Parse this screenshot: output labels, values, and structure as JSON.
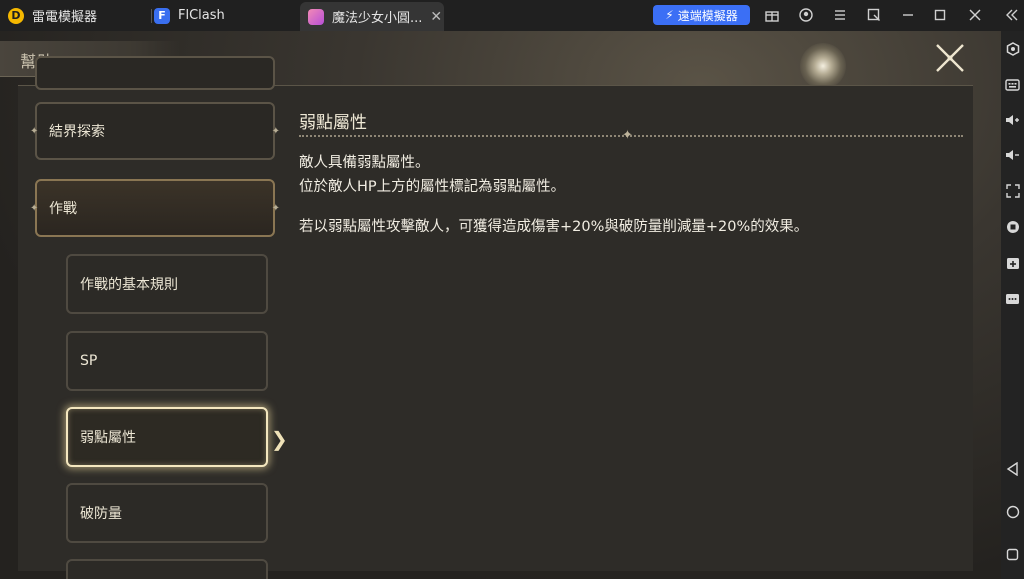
{
  "titlebar": {
    "tabs": [
      {
        "label": "雷電模擬器"
      },
      {
        "label": "FlClash"
      },
      {
        "label": "魔法少女小圓...",
        "close": "✕"
      }
    ],
    "remote_button": "遠端模擬器"
  },
  "game": {
    "header_title": "幫助",
    "categories": [
      {
        "label": "結界探索"
      },
      {
        "label": "作戰"
      }
    ],
    "sub_items": [
      {
        "label": "作戰的基本規則"
      },
      {
        "label": "SP"
      },
      {
        "label": "弱點屬性"
      },
      {
        "label": "破防量"
      }
    ],
    "detail": {
      "title": "弱點屬性",
      "lines": [
        "敵人具備弱點屬性。",
        "位於敵人HP上方的屬性標記為弱點屬性。",
        "若以弱點屬性攻擊敵人，可獲得造成傷害+20%與破防量削減量+20%的效果。"
      ]
    }
  },
  "colors": {
    "accent": "#3b6ff5",
    "highlight": "#f4e7bf"
  }
}
